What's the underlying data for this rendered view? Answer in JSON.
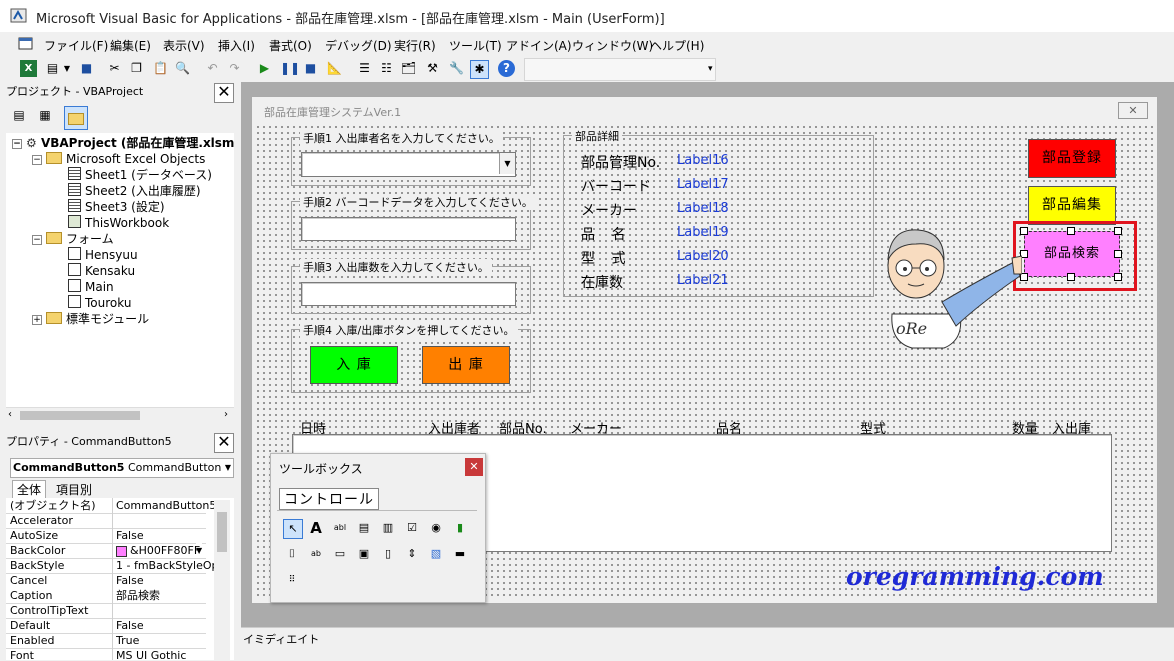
{
  "app": {
    "title": "Microsoft Visual Basic for Applications - 部品在庫管理.xlsm - [部品在庫管理.xlsm - Main (UserForm)]"
  },
  "menu": [
    "ファイル(F)",
    "編集(E)",
    "表示(V)",
    "挿入(I)",
    "書式(O)",
    "デバッグ(D)",
    "実行(R)",
    "ツール(T)",
    "アドイン(A)",
    "ウィンドウ(W)",
    "ヘルプ(H)"
  ],
  "project": {
    "title": "プロジェクト - VBAProject",
    "root": "VBAProject (部品在庫管理.xlsm",
    "excel_objects": "Microsoft Excel Objects",
    "sheets": [
      "Sheet1 (データベース)",
      "Sheet2 (入出庫履歴)",
      "Sheet3 (設定)",
      "ThisWorkbook"
    ],
    "forms_folder": "フォーム",
    "forms": [
      "Hensyuu",
      "Kensaku",
      "Main",
      "Touroku"
    ],
    "modules_folder": "標準モジュール"
  },
  "properties": {
    "title": "プロパティ - CommandButton5",
    "object_name": "CommandButton5",
    "object_type": "CommandButton",
    "tab_all": "全体",
    "tab_category": "項目別",
    "rows": [
      {
        "k": "(オブジェクト名)",
        "v": "CommandButton5"
      },
      {
        "k": "Accelerator",
        "v": ""
      },
      {
        "k": "AutoSize",
        "v": "False"
      },
      {
        "k": "BackColor",
        "v": "&H00FF80FF"
      },
      {
        "k": "BackStyle",
        "v": "1 - fmBackStyleOp"
      },
      {
        "k": "Cancel",
        "v": "False"
      },
      {
        "k": "Caption",
        "v": "部品検索"
      },
      {
        "k": "ControlTipText",
        "v": ""
      },
      {
        "k": "Default",
        "v": "False"
      },
      {
        "k": "Enabled",
        "v": "True"
      },
      {
        "k": "Font",
        "v": "MS UI Gothic"
      }
    ]
  },
  "form": {
    "caption": "部品在庫管理システムVer.1",
    "step1": "手順1 入出庫者名を入力してください。",
    "step2": "手順2 バーコードデータを入力してください。",
    "step3": "手順3 入出庫数を入力してください。",
    "step4": "手順4 入庫/出庫ボタンを押してください。",
    "btn_in": "入 庫",
    "btn_out": "出 庫",
    "detail_title": "部品詳細",
    "details": [
      {
        "label": "部品管理No.",
        "value": "Label16"
      },
      {
        "label": "バーコード",
        "value": "Label17"
      },
      {
        "label": "メーカー",
        "value": "Label18"
      },
      {
        "label": "品 名",
        "value": "Label19"
      },
      {
        "label": "型 式",
        "value": "Label20"
      },
      {
        "label": "在庫数",
        "value": "Label21"
      }
    ],
    "btn_register": "部品登録",
    "btn_edit": "部品編集",
    "btn_search": "部品検索",
    "cartoon_text": "oRe",
    "headers": [
      "日時",
      "入出庫者",
      "部品No.",
      "メーカー",
      "品名",
      "型式",
      "数量",
      "入出庫"
    ],
    "watermark": "oregramming.com"
  },
  "toolbox": {
    "title": "ツールボックス",
    "tab": "コントロール"
  },
  "immediate": {
    "title": "イミディエイト"
  },
  "colors": {
    "register": "#ff0000",
    "edit": "#ffff00",
    "search": "#ff80ff",
    "in": "#00ff00",
    "out": "#ff8000",
    "highlight": "#e0141e",
    "link": "#1a3bd6"
  }
}
